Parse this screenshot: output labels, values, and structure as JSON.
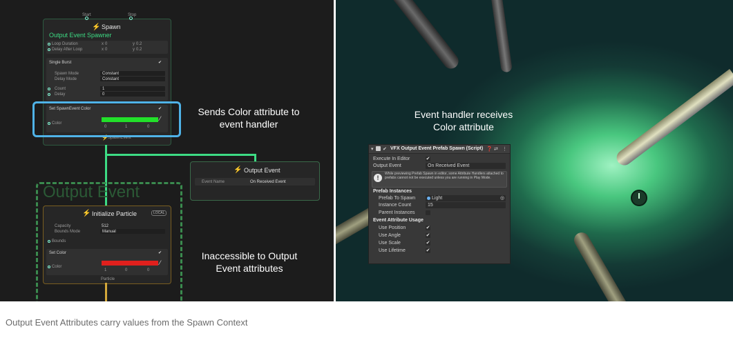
{
  "graph": {
    "spawn_node": {
      "start_label": "Start",
      "stop_label": "Stop",
      "title": "Spawn",
      "subtitle": "Output Event Spawner",
      "rows": [
        {
          "label": "Loop Duration",
          "x_label": "x",
          "x": "0",
          "y_label": "y",
          "y": "0.2"
        },
        {
          "label": "Delay After Loop",
          "x_label": "x",
          "x": "0",
          "y_label": "y",
          "y": "0.2"
        }
      ],
      "single_burst_label": "Single Burst",
      "spawn_mode_label": "Spawn Mode",
      "spawn_mode_value": "Constant",
      "delay_mode_label": "Delay Mode",
      "delay_mode_value": "Constant",
      "count_label": "Count",
      "count_value": "1",
      "delay_label": "Delay",
      "delay_value": "0",
      "set_color_title": "Set SpawnEvent Color",
      "color_label": "Color",
      "color_r": "0",
      "color_g": "1",
      "color_b": "0",
      "color_swatch": "#22e02a",
      "out_label": "SpawnEvent"
    },
    "output_event_node": {
      "title": "Output Event",
      "event_name_label": "Event Name",
      "event_name_value": "On Received Event"
    },
    "output_event_group_title": "Output Event",
    "init_node": {
      "title": "Initialize Particle",
      "badge": "LOCAL",
      "capacity_label": "Capacity",
      "capacity_value": "512",
      "bounds_mode_label": "Bounds Mode",
      "bounds_mode_value": "Manual",
      "bounds_label": "Bounds",
      "set_color_title": "Set Color",
      "color_label": "Color",
      "color_r": "1",
      "color_g": "0",
      "color_b": "0",
      "color_swatch": "#e0201d",
      "out_label": "Particle"
    },
    "annotation_sends": "Sends Color attribute to event handler",
    "annotation_inaccessible": "Inaccessible to Output Event attributes"
  },
  "scene": {
    "annotation_receives": "Event handler receives Color attribute"
  },
  "inspector": {
    "title": "VFX Output Event Prefab Spawn (Script)",
    "execute_in_editor_label": "Execute In Editor",
    "execute_in_editor_checked": true,
    "output_event_label": "Output Event",
    "output_event_value": "On Received Event",
    "warning": "While previewing Prefab Spawn in editor, some Attribute Handlers attached to prefabs cannot not be executed unless you are running in Play Mode.",
    "prefab_instances_header": "Prefab Instances",
    "prefab_to_spawn_label": "Prefab To Spawn",
    "prefab_to_spawn_value": "Light",
    "instance_count_label": "Instance Count",
    "instance_count_value": "15",
    "parent_instances_label": "Parent Instances",
    "usage_header": "Event Attribute Usage",
    "use_position_label": "Use Position",
    "use_angle_label": "Use Angle",
    "use_scale_label": "Use Scale",
    "use_lifetime_label": "Use Lifetime",
    "check_glyph": "✔"
  },
  "caption": "Output Event Attributes carry values from the Spawn Context",
  "colors": {
    "accent_green": "#3ddc84",
    "selection_blue": "#4fb3e8",
    "flow_yellow": "#d4a83a"
  }
}
